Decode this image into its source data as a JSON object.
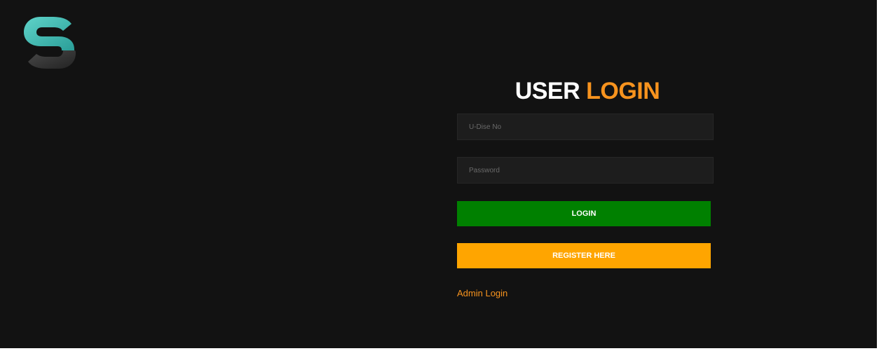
{
  "brand": {
    "logo_icon": "s-logo-icon",
    "colors": {
      "teal": "#3fb8b1",
      "dark_gray": "#2e2e2e",
      "background": "#121212"
    }
  },
  "login": {
    "title_part1": "USER",
    "title_part2": "LOGIN",
    "title_accent_color": "#f7931e",
    "udise_placeholder": "U-Dise No",
    "udise_value": "",
    "password_placeholder": "Password",
    "password_value": "",
    "login_button": "LOGIN",
    "login_button_color": "#008000",
    "register_button": "REGISTER HERE",
    "register_button_color": "#ffa500",
    "admin_link": "Admin Login"
  }
}
